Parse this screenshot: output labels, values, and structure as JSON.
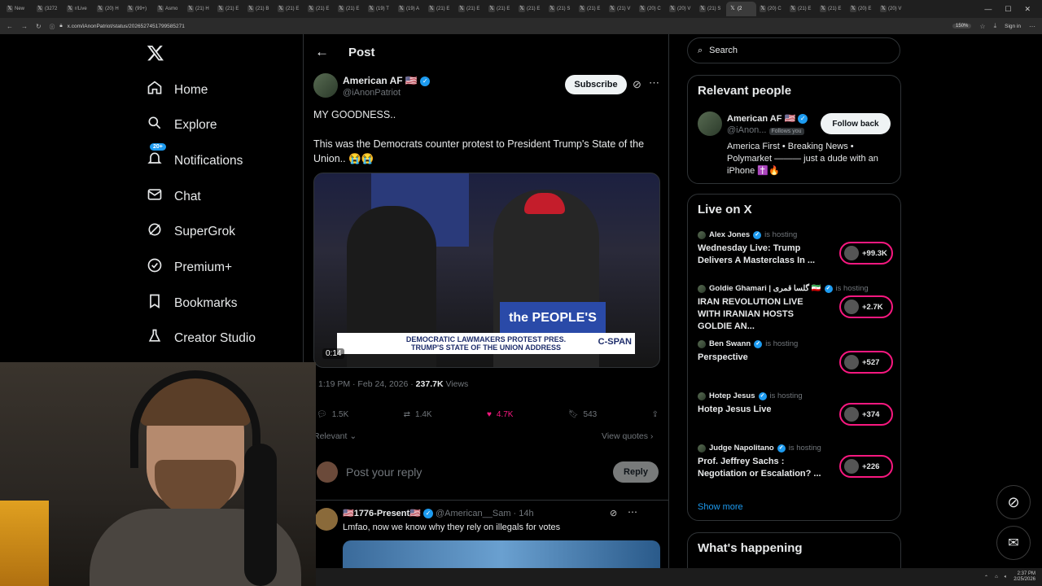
{
  "browser": {
    "tabs": [
      {
        "label": "New"
      },
      {
        "label": "(3272"
      },
      {
        "label": "r/Live"
      },
      {
        "label": "(20) H"
      },
      {
        "label": "(99+)"
      },
      {
        "label": "Asmo"
      },
      {
        "label": "(21) H"
      },
      {
        "label": "(21) E"
      },
      {
        "label": "(21) B"
      },
      {
        "label": "(21) E"
      },
      {
        "label": "(21) E"
      },
      {
        "label": "(21) E"
      },
      {
        "label": "(19) T"
      },
      {
        "label": "(19) A"
      },
      {
        "label": "(21) E"
      },
      {
        "label": "(21) E"
      },
      {
        "label": "(21) E"
      },
      {
        "label": "(21) E"
      },
      {
        "label": "(21) S"
      },
      {
        "label": "(21) E"
      },
      {
        "label": "(21) V"
      },
      {
        "label": "(20) C"
      },
      {
        "label": "(20) V"
      },
      {
        "label": "(21) S"
      },
      {
        "label": "(2"
      },
      {
        "label": "(20) C"
      },
      {
        "label": "(21) E"
      },
      {
        "label": "(21) E"
      },
      {
        "label": "(20) E"
      },
      {
        "label": "(20) V"
      }
    ],
    "active_tab_index": 24,
    "url": "x.com/iAnonPatriot/status/2026527451799585271",
    "zoom": "150%",
    "sign_in": "Sign in"
  },
  "nav": {
    "items": [
      {
        "label": "Home",
        "icon": "home-icon"
      },
      {
        "label": "Explore",
        "icon": "search-icon"
      },
      {
        "label": "Notifications",
        "icon": "bell-icon",
        "badge": "20+"
      },
      {
        "label": "Chat",
        "icon": "mail-icon"
      },
      {
        "label": "SuperGrok",
        "icon": "grok-icon"
      },
      {
        "label": "Premium+",
        "icon": "verified-icon"
      },
      {
        "label": "Bookmarks",
        "icon": "bookmark-icon"
      },
      {
        "label": "Creator Studio",
        "icon": "flask-icon"
      }
    ]
  },
  "post": {
    "header_title": "Post",
    "author_name": "American AF 🇺🇸",
    "author_handle": "@iAnonPatriot",
    "subscribe_label": "Subscribe",
    "text_line1": "MY GOODNESS..",
    "text_line2": "This was the Democrats counter protest to President Trump's State of the Union.. 😭😭",
    "video": {
      "chyron_line1": "DEMOCRATIC LAWMAKERS PROTEST PRES.",
      "chyron_line2": "TRUMP'S STATE OF THE UNION ADDRESS",
      "network": "C-SPAN",
      "duration": "0:14",
      "sign_text": "the PEOPLE'S"
    },
    "timestamp": "1:19 PM · Feb 24, 2026",
    "views_count": "237.7K",
    "views_label": "Views",
    "replies": "1.5K",
    "reposts": "1.4K",
    "likes": "4.7K",
    "bookmarks": "543",
    "sort_label": "Relevant",
    "view_quotes": "View quotes",
    "reply_placeholder": "Post your reply",
    "reply_button": "Reply",
    "reply1": {
      "name": "🇺🇸1776-Present🇺🇸",
      "handle": "@American__Sam · 14h",
      "text": "Lmfao, now we know why they rely on illegals for votes"
    }
  },
  "right": {
    "search_placeholder": "Search",
    "relevant": {
      "title": "Relevant people",
      "name": "American AF 🇺🇸",
      "handle": "@iAnon...",
      "follows_you": "Follows you",
      "follow_label": "Follow back",
      "bio": "America First • Breaking News • Polymarket ——— just a dude with an iPhone ✝️🔥"
    },
    "live": {
      "title": "Live on X",
      "hosting_label": "is hosting",
      "items": [
        {
          "host": "Alex Jones",
          "title": "Wednesday Live: Trump Delivers A Masterclass In ...",
          "count": "+99.3K"
        },
        {
          "host": "Goldie Ghamari | گلسا قمری 🇮🇷",
          "title": "IRAN REVOLUTION LIVE WITH IRANIAN HOSTS GOLDIE AN...",
          "count": "+2.7K"
        },
        {
          "host": "Ben Swann",
          "title": "Perspective",
          "count": "+527"
        },
        {
          "host": "Hotep Jesus",
          "title": "Hotep Jesus Live",
          "count": "+374"
        },
        {
          "host": "Judge Napolitano",
          "title": "Prof. Jeffrey Sachs : Negotiation or Escalation? ...",
          "count": "+226"
        }
      ],
      "show_more": "Show more"
    },
    "happening_title": "What's happening"
  },
  "taskbar": {
    "time": "2:37 PM",
    "date": "2/25/2026"
  },
  "colors": {
    "accent": "#1d9bf0",
    "like": "#f91880",
    "bg": "#000000",
    "border": "#2f3336"
  }
}
